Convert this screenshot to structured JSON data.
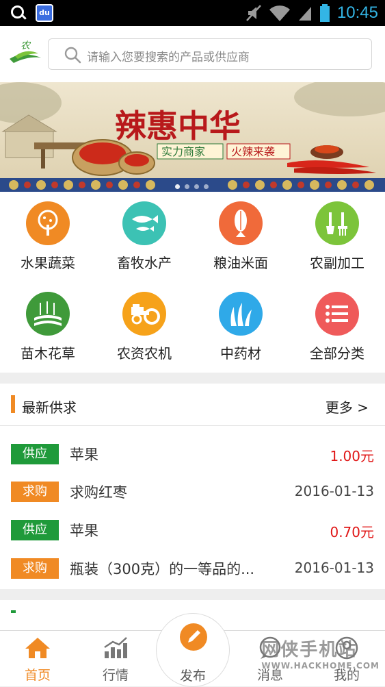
{
  "status_bar": {
    "time": "10:45",
    "time_color": "#33b5e5",
    "baidu_label": "du",
    "icons": [
      "search-icon",
      "baidu-icon",
      "mute-icon",
      "wifi-icon",
      "signal-icon",
      "battery-icon"
    ]
  },
  "header": {
    "logo_text": "农",
    "search_placeholder": "请输入您要搜索的产品或供应商"
  },
  "banner": {
    "headline": "辣惠中华",
    "slogan_left": "实力商家",
    "slogan_right": "火辣来袭",
    "page_count": 4,
    "active_page": 1
  },
  "categories": [
    {
      "label": "水果蔬菜",
      "icon": "fruit-tree-icon",
      "color": "#f08a24"
    },
    {
      "label": "畜牧水产",
      "icon": "fish-icon",
      "color": "#3cc2b4"
    },
    {
      "label": "粮油米面",
      "icon": "corn-icon",
      "color": "#f06a3a"
    },
    {
      "label": "农副加工",
      "icon": "farm-tools-icon",
      "color": "#7cc43a"
    },
    {
      "label": "苗木花草",
      "icon": "field-icon",
      "color": "#3f9a3a"
    },
    {
      "label": "农资农机",
      "icon": "tractor-icon",
      "color": "#f6a21a"
    },
    {
      "label": "中药材",
      "icon": "herb-icon",
      "color": "#2fa9e8"
    },
    {
      "label": "全部分类",
      "icon": "list-icon",
      "color": "#ef5a5a"
    }
  ],
  "supply": {
    "title": "最新供求",
    "more": "更多 >",
    "accent": "#f08a24",
    "items": [
      {
        "tag": "供应",
        "type": "sup",
        "name": "苹果",
        "value": "1.00元",
        "is_price": true
      },
      {
        "tag": "求购",
        "type": "buy",
        "name": "求购红枣",
        "value": "2016-01-13",
        "is_price": false
      },
      {
        "tag": "供应",
        "type": "sup",
        "name": "苹果",
        "value": "0.70元",
        "is_price": true
      },
      {
        "tag": "求购",
        "type": "buy",
        "name": "瓶装（300克）的一等品的...",
        "value": "2016-01-13",
        "is_price": false
      }
    ]
  },
  "nav": {
    "items": [
      {
        "label": "首页",
        "icon": "home-icon",
        "active": true
      },
      {
        "label": "行情",
        "icon": "chart-icon",
        "active": false
      },
      {
        "label": "发布",
        "icon": "pencil-icon",
        "active": false
      },
      {
        "label": "消息",
        "icon": "message-icon",
        "active": false
      },
      {
        "label": "我的",
        "icon": "user-icon",
        "active": false
      }
    ]
  },
  "watermark": {
    "text": "网侠手机站",
    "url": "WWW.HACKHOME.COM"
  }
}
